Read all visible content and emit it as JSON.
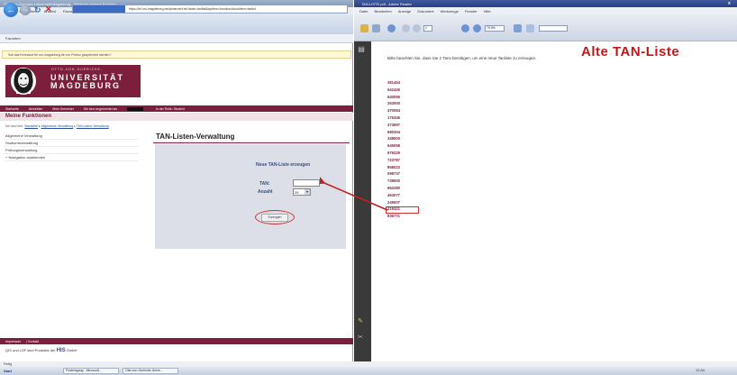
{
  "browser": {
    "title": "Otto-von-Guericke-Universität Magdeburg - Windows Internet Explorer",
    "menu": [
      "Datei",
      "Bearbeiten",
      "Ansicht",
      "Favoriten",
      "Extras",
      "?"
    ],
    "address": "https://lsf.uni-magdeburg.de/qisserver/rds?state=tanlist&topitem=functions&subitem=tanlist",
    "favorite_tab": "Favoriten",
    "notice": "Soll das Kennwort für uni-magdeburg.de von Firefox gespeichert werden?",
    "logo": {
      "small": "OTTO-VON-GUERICKE-",
      "line1": "UNIVERSITÄT",
      "line2": "MAGDEBURG"
    },
    "topnav": [
      "Startseite",
      "Abmelden",
      "Mein Semester",
      "Sie sind angemeldet als",
      "in der Rolle: Student"
    ],
    "func_title": "Meine Funktionen",
    "breadcrumb": {
      "prefix": "Sie sind hier:",
      "items": [
        "Startseite",
        "Allgemeine Verwaltung",
        "TAN-Listen-Verwaltung"
      ]
    },
    "sidebar": [
      "Allgemeine Verwaltung",
      "Studiumsverwaltung",
      "Prüfungsverwaltung",
      "+ Navigation ausblenden"
    ],
    "page_heading": "TAN-Listen-Verwaltung",
    "form": {
      "title": "Neue TAN-Liste erzeugen",
      "tan_label": "TAN:",
      "count_label": "Anzahl",
      "count_value": "25",
      "submit_label": "Erzeugen"
    },
    "footer": {
      "links": [
        "Impressum",
        "Kontakt"
      ],
      "text": "QIS und LSF sind Produkte der",
      "brand": "HIS",
      "suffix": "GmbH"
    },
    "status": "Fertig"
  },
  "reader": {
    "title": "TAN-LISTE.pdf - Adobe Reader",
    "menu": [
      "Datei",
      "Bearbeiten",
      "Anzeige",
      "Dokument",
      "Werkzeuge",
      "Fenster",
      "Hilfe"
    ],
    "page_field": "1",
    "zoom": "79,5%",
    "close": "x",
    "pdf_title": "Alte TAN-Liste",
    "pdf_subtitle": "Bitte beachten Sie, dass Sie 2 Tans benötigen, um eine neue Tanliste zu erzeugen.",
    "tans": [
      "381454",
      "542426",
      "640056",
      "263000",
      "470064",
      "176346",
      "473697",
      "680304",
      "348500",
      "645058",
      "979229",
      "723787",
      "858023",
      "098737",
      "738500",
      "652280",
      "463077",
      "249007",
      "219321",
      "836771"
    ]
  },
  "taskbar": {
    "start": "Start",
    "items": [
      "Posteingang - Microsoft...",
      "Otto-von-Guericke-Unive..."
    ],
    "clock": "12:34"
  }
}
